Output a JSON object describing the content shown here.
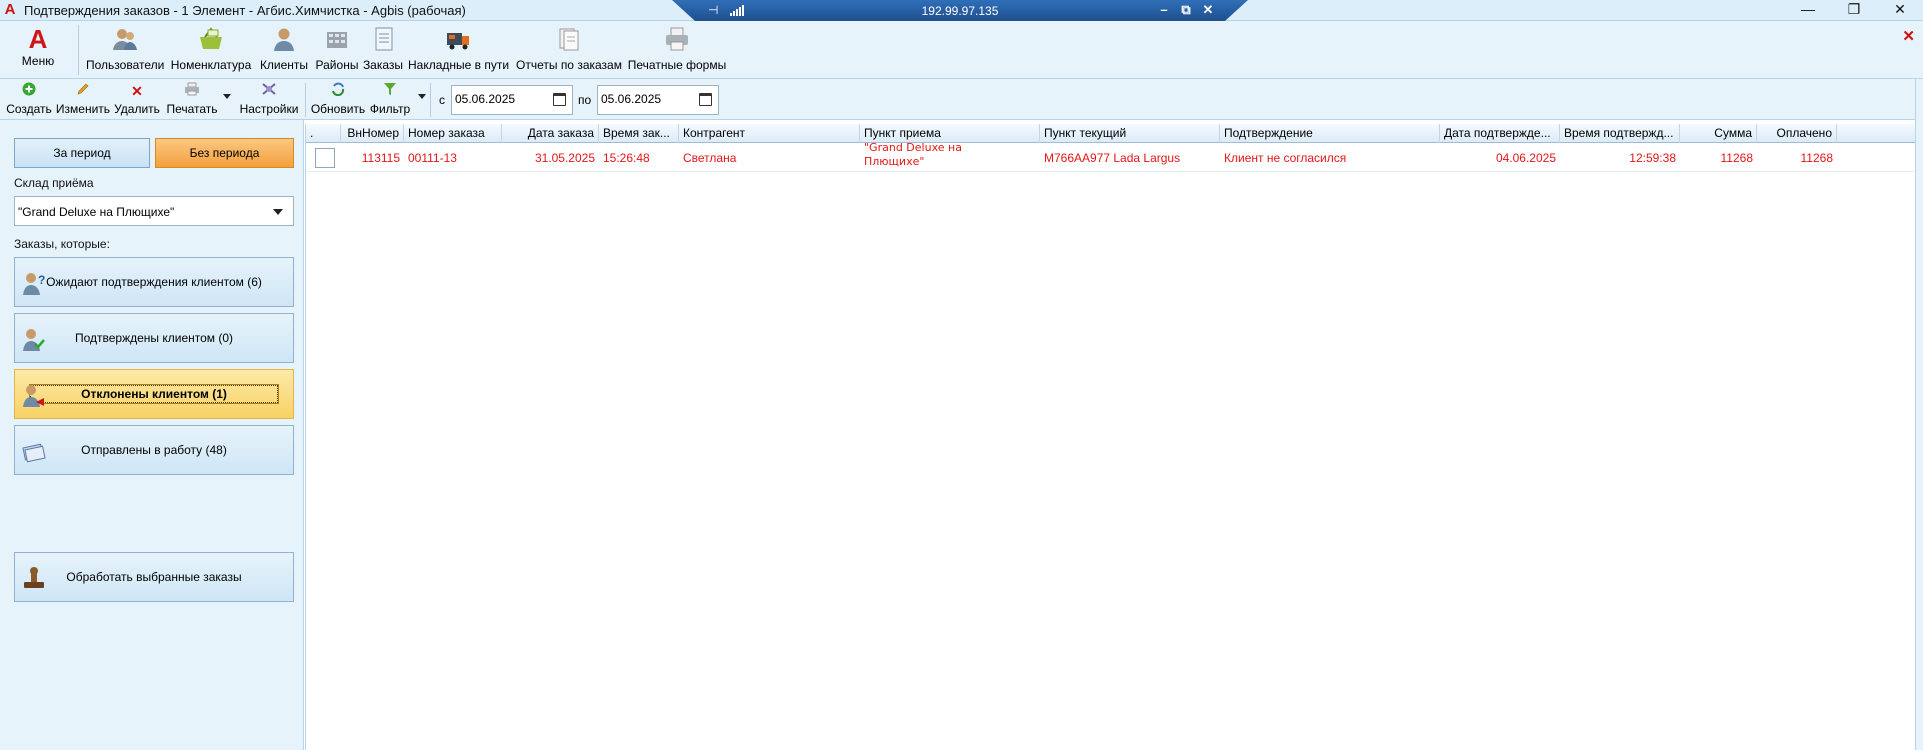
{
  "titlebar": {
    "title": "Подтверждения заказов - 1 Элемент - Агбис.Химчистка - Agbis (рабочая)",
    "logo": "A",
    "rdp_ip": "192.99.97.135",
    "rdp_pin": "⊣",
    "rdp_min": "–",
    "rdp_restore": "⧉",
    "rdp_close": "✕",
    "win_min": "—",
    "win_max": "❐",
    "win_close": "✕"
  },
  "toolbar1": {
    "menu_logo": "A",
    "menu_label": "Меню",
    "items": [
      {
        "label": "Пользователи",
        "icon": "users-icon"
      },
      {
        "label": "Номенклатура",
        "icon": "basket-icon"
      },
      {
        "label": "Клиенты",
        "icon": "client-icon"
      },
      {
        "label": "Районы",
        "icon": "districts-icon"
      },
      {
        "label": "Заказы",
        "icon": "orders-icon"
      },
      {
        "label": "Накладные в пути",
        "icon": "truck-icon"
      },
      {
        "label": "Отчеты по заказам",
        "icon": "reports-icon"
      },
      {
        "label": "Печатные формы",
        "icon": "printer-icon"
      }
    ],
    "close_glyph": "✕"
  },
  "toolbar2": {
    "create": "Создать",
    "edit": "Изменить",
    "delete": "Удалить",
    "print": "Печатать",
    "settings": "Настройки",
    "refresh": "Обновить",
    "filter": "Фильтр",
    "date_from_label": "с",
    "date_from": "05.06.2025",
    "date_to_label": "по",
    "date_to": "05.06.2025"
  },
  "left_panel": {
    "period_btn": "За период",
    "no_period_btn": "Без периода",
    "warehouse_label": "Склад приёма",
    "warehouse_value": "\"Grand Deluxe на Плющихе\"",
    "orders_label": "Заказы, которые:",
    "buttons": [
      {
        "label": "Ожидают подтверждения клиентом (6)"
      },
      {
        "label": "Подтверждены клиентом (0)"
      },
      {
        "label": "Отклонены клиентом (1)"
      },
      {
        "label": "Отправлены в работу (48)"
      }
    ],
    "process_btn": "Обработать выбранные заказы"
  },
  "grid": {
    "columns": [
      ".",
      "ВнНомер",
      "Номер заказа",
      "Дата заказа",
      "Время зак...",
      "Контрагент",
      "Пункт приема",
      "Пункт текущий",
      "Подтверждение",
      "Дата подтвержде...",
      "Время подтвержд...",
      "Сумма",
      "Оплачено"
    ],
    "rows": [
      {
        "vn": "113115",
        "order_no": "00111-13",
        "date": "31.05.2025",
        "time": "15:26:48",
        "counterparty": "Светлана",
        "reception_point": "\"Grand Deluxe на Плющихе\"",
        "current_point": "M766AA977 Lada Largus",
        "confirmation": "Клиент не согласился",
        "confirm_date": "04.06.2025",
        "confirm_time": "12:59:38",
        "sum": "11268",
        "paid": "11268"
      }
    ]
  },
  "colors": {
    "row_text": "#e51616",
    "accent_orange": "#f3a03c",
    "active_yellow": "#f8d265",
    "panel_bg": "#e6f3fb"
  }
}
